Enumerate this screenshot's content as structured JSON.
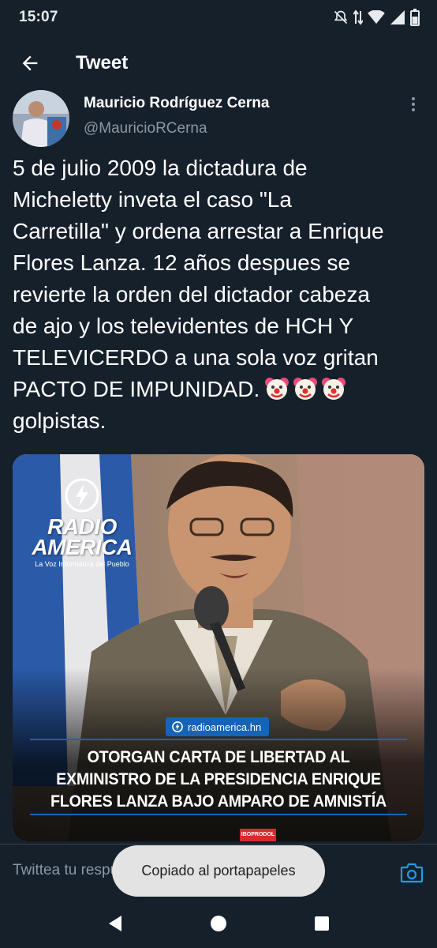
{
  "status_bar": {
    "time": "15:07"
  },
  "header": {
    "title": "Tweet"
  },
  "tweet": {
    "author_name": "Mauricio Rodríguez Cerna",
    "author_handle": "@MauricioRCerna",
    "text_lines": [
      "5 de julio 2009 la dictadura de",
      "Micheletty inveta el caso \"La",
      "Carretilla\" y ordena arrestar a Enrique",
      "Flores Lanza. 12 años despues se",
      "revierte la orden del dictador cabeza",
      "de ajo y los televidentes de HCH Y",
      "TELEVICERDO a una sola voz gritan",
      "PACTO DE IMPUNIDAD.",
      "golpistas."
    ],
    "emojis": [
      "clown-face",
      "clown-face",
      "clown-face"
    ]
  },
  "media": {
    "logo_line1": "RADIO",
    "logo_line2": "AMERICA",
    "logo_slogan": "La Voz Informativa del Pueblo",
    "source": "radioamerica.hn",
    "caption_lines": [
      "OTORGAN CARTA DE LIBERTAD AL",
      "EXMINISTRO DE LA PRESIDENCIA ENRIQUE",
      "FLORES LANZA BAJO AMPARO DE AMNISTÍA"
    ],
    "sponsor": "IBOPRODOL"
  },
  "reply": {
    "placeholder": "Twittea tu respuesta"
  },
  "toast": {
    "message": "Copiado al portapapeles"
  },
  "colors": {
    "background": "#15202b",
    "accent": "#1d9bf0",
    "muted": "#8b98a5"
  }
}
